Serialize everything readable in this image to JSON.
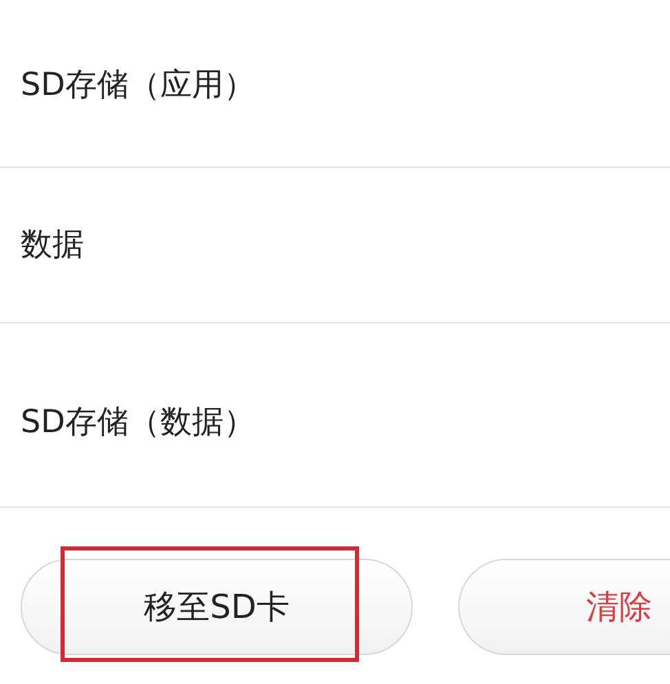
{
  "rows": [
    {
      "label": "SD存储（应用）"
    },
    {
      "label": "数据"
    },
    {
      "label": "SD存储（数据）"
    }
  ],
  "buttons": [
    {
      "label": "移至SD卡",
      "kind": "normal",
      "highlighted": true
    },
    {
      "label": "清除",
      "kind": "danger",
      "highlighted": false
    }
  ]
}
